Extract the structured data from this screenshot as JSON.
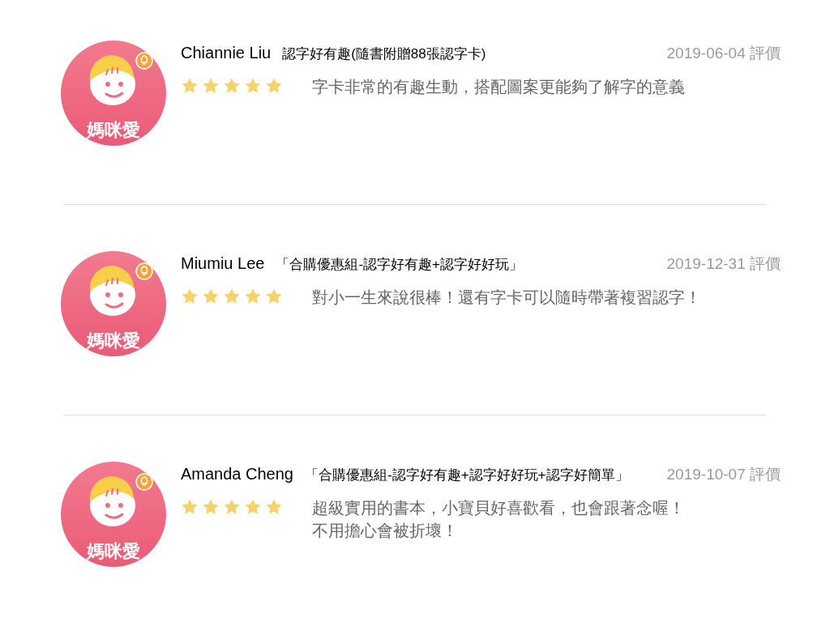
{
  "reviews": [
    {
      "avatar_label": "媽咪愛",
      "name": "Chiannie Liu",
      "product": "認字好有趣(隨書附贈88張認字卡)",
      "date": "2019-06-04 評價",
      "stars": 5,
      "comment": [
        "字卡非常的有趣生動，搭配圖案更能夠了解字的意義"
      ]
    },
    {
      "avatar_label": "媽咪愛",
      "name": "Miumiu Lee",
      "product": "「合購優惠組-認字好有趣+認字好好玩」",
      "date": "2019-12-31 評價",
      "stars": 5,
      "comment": [
        "對小一生來說很棒！還有字卡可以隨時帶著複習認字！"
      ]
    },
    {
      "avatar_label": "媽咪愛",
      "name": "Amanda Cheng",
      "product": "「合購優惠組-認字好有趣+認字好好玩+認字好簡單」",
      "date": "2019-10-07 評價",
      "stars": 5,
      "comment": [
        "超級實用的書本，小寶貝好喜歡看，也會跟著念喔！",
        "不用擔心會被折壞！"
      ]
    }
  ]
}
